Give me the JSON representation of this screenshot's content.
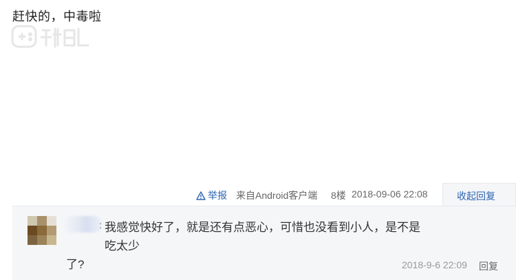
{
  "post": {
    "text": "赶快的，中毒啦"
  },
  "meta": {
    "report_label": "举报",
    "source": "来自Android客户端",
    "floor": "8楼",
    "time": "2018-09-06 22:08",
    "collapse_reply_label": "收起回复"
  },
  "reply": {
    "colon": ":",
    "content_line1": "我感觉快好了，就是还有点恶心，可惜也没看到小人，是不是吃太少",
    "content_line2": "了?",
    "time": "2018-9-6 22:09",
    "reply_label": "回复"
  },
  "colors": {
    "link": "#2d64b3",
    "meta_text": "#666666",
    "reply_bg": "#f5f6f8",
    "avatar_pixels": [
      "#cfc7ae",
      "#a8906a",
      "#e6e0d4",
      "#6b4a22",
      "#8a6a3a",
      "#b39a72",
      "#7d6440",
      "#9c8258",
      "#c8b68e"
    ]
  },
  "icons": {
    "report": "warning-triangle-icon",
    "watermark": "gamepad-logo-icon"
  }
}
